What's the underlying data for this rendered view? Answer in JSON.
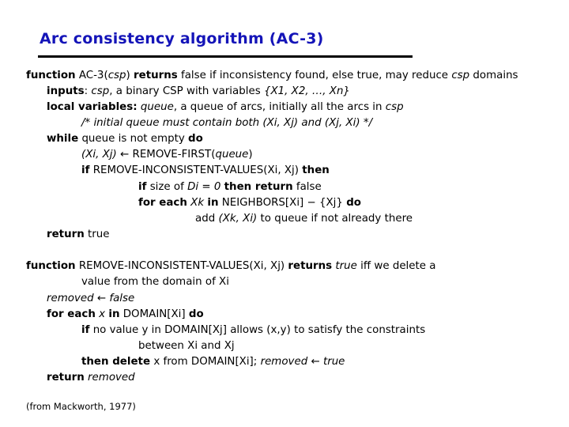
{
  "title": "Arc consistency algorithm (AC-3)",
  "ac3": {
    "l1": {
      "kw1": "function",
      "name": "AC-3(",
      "arg": "csp",
      ") ": ")",
      "kw2": "returns",
      "rest": "false if inconsistency found, else true, may reduce ",
      "csp": "csp",
      "end": " domains"
    },
    "l2": {
      "kw": "inputs",
      "a": ": ",
      "csp": "csp",
      "b": ", a binary CSP with variables ",
      "vars": "{X1, X2, …, Xn}"
    },
    "l3": {
      "kw": "local variables:",
      "q": "queue",
      "rest": ", a queue of arcs, initially all the arcs in ",
      "csp": "csp"
    },
    "l4": {
      "text": "/* initial queue must contain both (Xi, Xj) and (Xj, Xi) */"
    },
    "l5": {
      "kw": "while",
      "mid": "queue is not empty",
      "kw2": "do"
    },
    "l6": {
      "pair": "(Xi, Xj)",
      "arrow": "←",
      "fn": "REMOVE-FIRST(",
      "q": "queue",
      "close": ")"
    },
    "l7": {
      "kw": "if",
      "fn": "REMOVE-INCONSISTENT-VALUES(Xi, Xj)",
      "kw2": "then"
    },
    "l8": {
      "kw": "if",
      "a": "size of",
      "d": "Di = 0",
      "kw2": "then return",
      "v": "false"
    },
    "l9": {
      "kw": "for each",
      "xk": "Xk",
      "kw2": "in",
      "fn": "NEIGHBORS[Xi] − {Xj}",
      "kw3": "do"
    },
    "l10": {
      "a": "add",
      "pair": "(Xk, Xi)",
      "b": "to queue if not already there"
    },
    "l11": {
      "kw": "return",
      "v": "true"
    }
  },
  "riv": {
    "l1": {
      "kw": "function",
      "fn": "REMOVE-INCONSISTENT-VALUES(Xi, Xj)",
      "kw2": "returns",
      "t": "true",
      "rest": "iff we delete a"
    },
    "l2": {
      "text": "value from the domain of Xi"
    },
    "l3": {
      "text": "removed ← false"
    },
    "l4": {
      "kw": "for each",
      "x": "x",
      "kw2": "in",
      "fn": "DOMAIN[Xi]",
      "kw3": "do"
    },
    "l5": {
      "kw": "if",
      "text": "no value y in DOMAIN[Xj] allows (x,y) to satisfy the constraints"
    },
    "l6": {
      "text": "between Xi and Xj"
    },
    "l7": {
      "kw": "then delete",
      "text": "x from DOMAIN[Xi];",
      "r": "removed ← true"
    },
    "l8": {
      "kw": "return",
      "v": "removed"
    }
  },
  "source": "(from Mackworth, 1977)"
}
